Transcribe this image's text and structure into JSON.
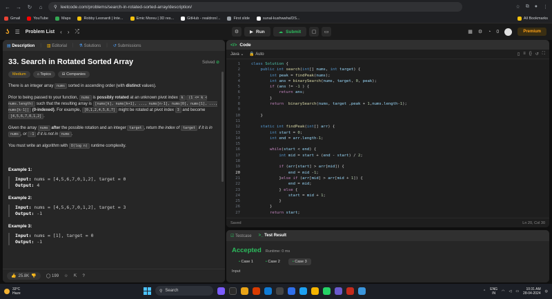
{
  "browser": {
    "url": "leetcode.com/problems/search-in-rotated-sorted-array/description/",
    "bookmarks": [
      "Gmail",
      "YouTube",
      "Maps",
      "Robby Leonardi | Inte...",
      "Emic Moreu | 3D res...",
      "GitHub - realdron/...",
      "First slide",
      "sunal-kushwaha/DS..."
    ],
    "all_bookmarks": "All Bookmarks"
  },
  "header": {
    "problem_list": "Problem List",
    "run": "Run",
    "submit": "Submit",
    "streak": "0",
    "premium": "Premium"
  },
  "left_tabs": [
    "Description",
    "Editorial",
    "Solutions",
    "Submissions"
  ],
  "problem": {
    "title": "33. Search in Rotated Sorted Array",
    "solved": "Solved",
    "difficulty": "Medium",
    "topics": "Topics",
    "companies": "Companies",
    "p1_a": "There is an integer array ",
    "p1_code": "nums",
    "p1_b": " sorted in ascending order (with ",
    "p1_bold": "distinct",
    "p1_c": " values).",
    "p2_a": "Prior to being passed to your function, ",
    "p2_code1": "nums",
    "p2_b": " is ",
    "p2_bold": "possibly rotated",
    "p2_c": " at an unknown pivot index ",
    "p2_code2": "k",
    "p2_code3": "(1 <= k < nums.length)",
    "p2_d": " such that the resulting array is ",
    "p2_code4": "[nums[k], nums[k+1], ..., nums[n-1], nums[0], nums[1], ..., nums[k-1]]",
    "p2_e": " ",
    "p2_bold2": "(0-indexed)",
    "p2_f": ". For example, ",
    "p2_code5": "[0,1,2,4,5,6,7]",
    "p2_g": " might be rotated at pivot index ",
    "p2_code6": "3",
    "p2_h": " and become ",
    "p2_code7": "[4,5,6,7,0,1,2]",
    "p2_i": ".",
    "p3_a": "Given the array ",
    "p3_code1": "nums",
    "p3_bold": " after",
    "p3_b": " the possible rotation and an integer ",
    "p3_code2": "target",
    "p3_c": ", return ",
    "p3_it": "the index of ",
    "p3_code3": "target",
    "p3_it2": " if it is in ",
    "p3_code4": "nums",
    "p3_it3": ", or ",
    "p3_code5": "-1",
    "p3_it4": " if it is not in ",
    "p3_code6": "nums",
    "p3_d": ".",
    "p4_a": "You must write an algorithm with ",
    "p4_code": "O(log n)",
    "p4_b": " runtime complexity.",
    "examples": [
      {
        "title": "Example 1:",
        "input_label": "Input:",
        "input": " nums = [4,5,6,7,0,1,2], target = 0",
        "output_label": "Output:",
        "output": " 4"
      },
      {
        "title": "Example 2:",
        "input_label": "Input:",
        "input": " nums = [4,5,6,7,0,1,2], target = 3",
        "output_label": "Output:",
        "output": " -1"
      },
      {
        "title": "Example 3:",
        "input_label": "Input:",
        "input": " nums = [1], target = 0",
        "output_label": "Output:",
        "output": " -1"
      }
    ]
  },
  "left_footer": {
    "likes": "25.8K",
    "comments": "199"
  },
  "code_panel": {
    "title": "Code",
    "language": "Java",
    "mode": "Auto",
    "status": "Saved",
    "position": "Ln 20, Col 30"
  },
  "test_panel": {
    "tab_testcase": "Testcase",
    "tab_result": "Test Result",
    "verdict": "Accepted",
    "runtime": "Runtime: 0 ms",
    "cases": [
      "Case 1",
      "Case 2",
      "Case 3"
    ],
    "input_label": "Input"
  },
  "taskbar": {
    "temp": "33°C",
    "weather": "Haze",
    "search": "Search",
    "lang": "ENG",
    "region": "IN",
    "time": "10:31 AM",
    "date": "28-04-2024"
  },
  "colors": {
    "accepted": "#2cbb5d",
    "medium": "#ffb800",
    "premium": "#ffa116"
  }
}
